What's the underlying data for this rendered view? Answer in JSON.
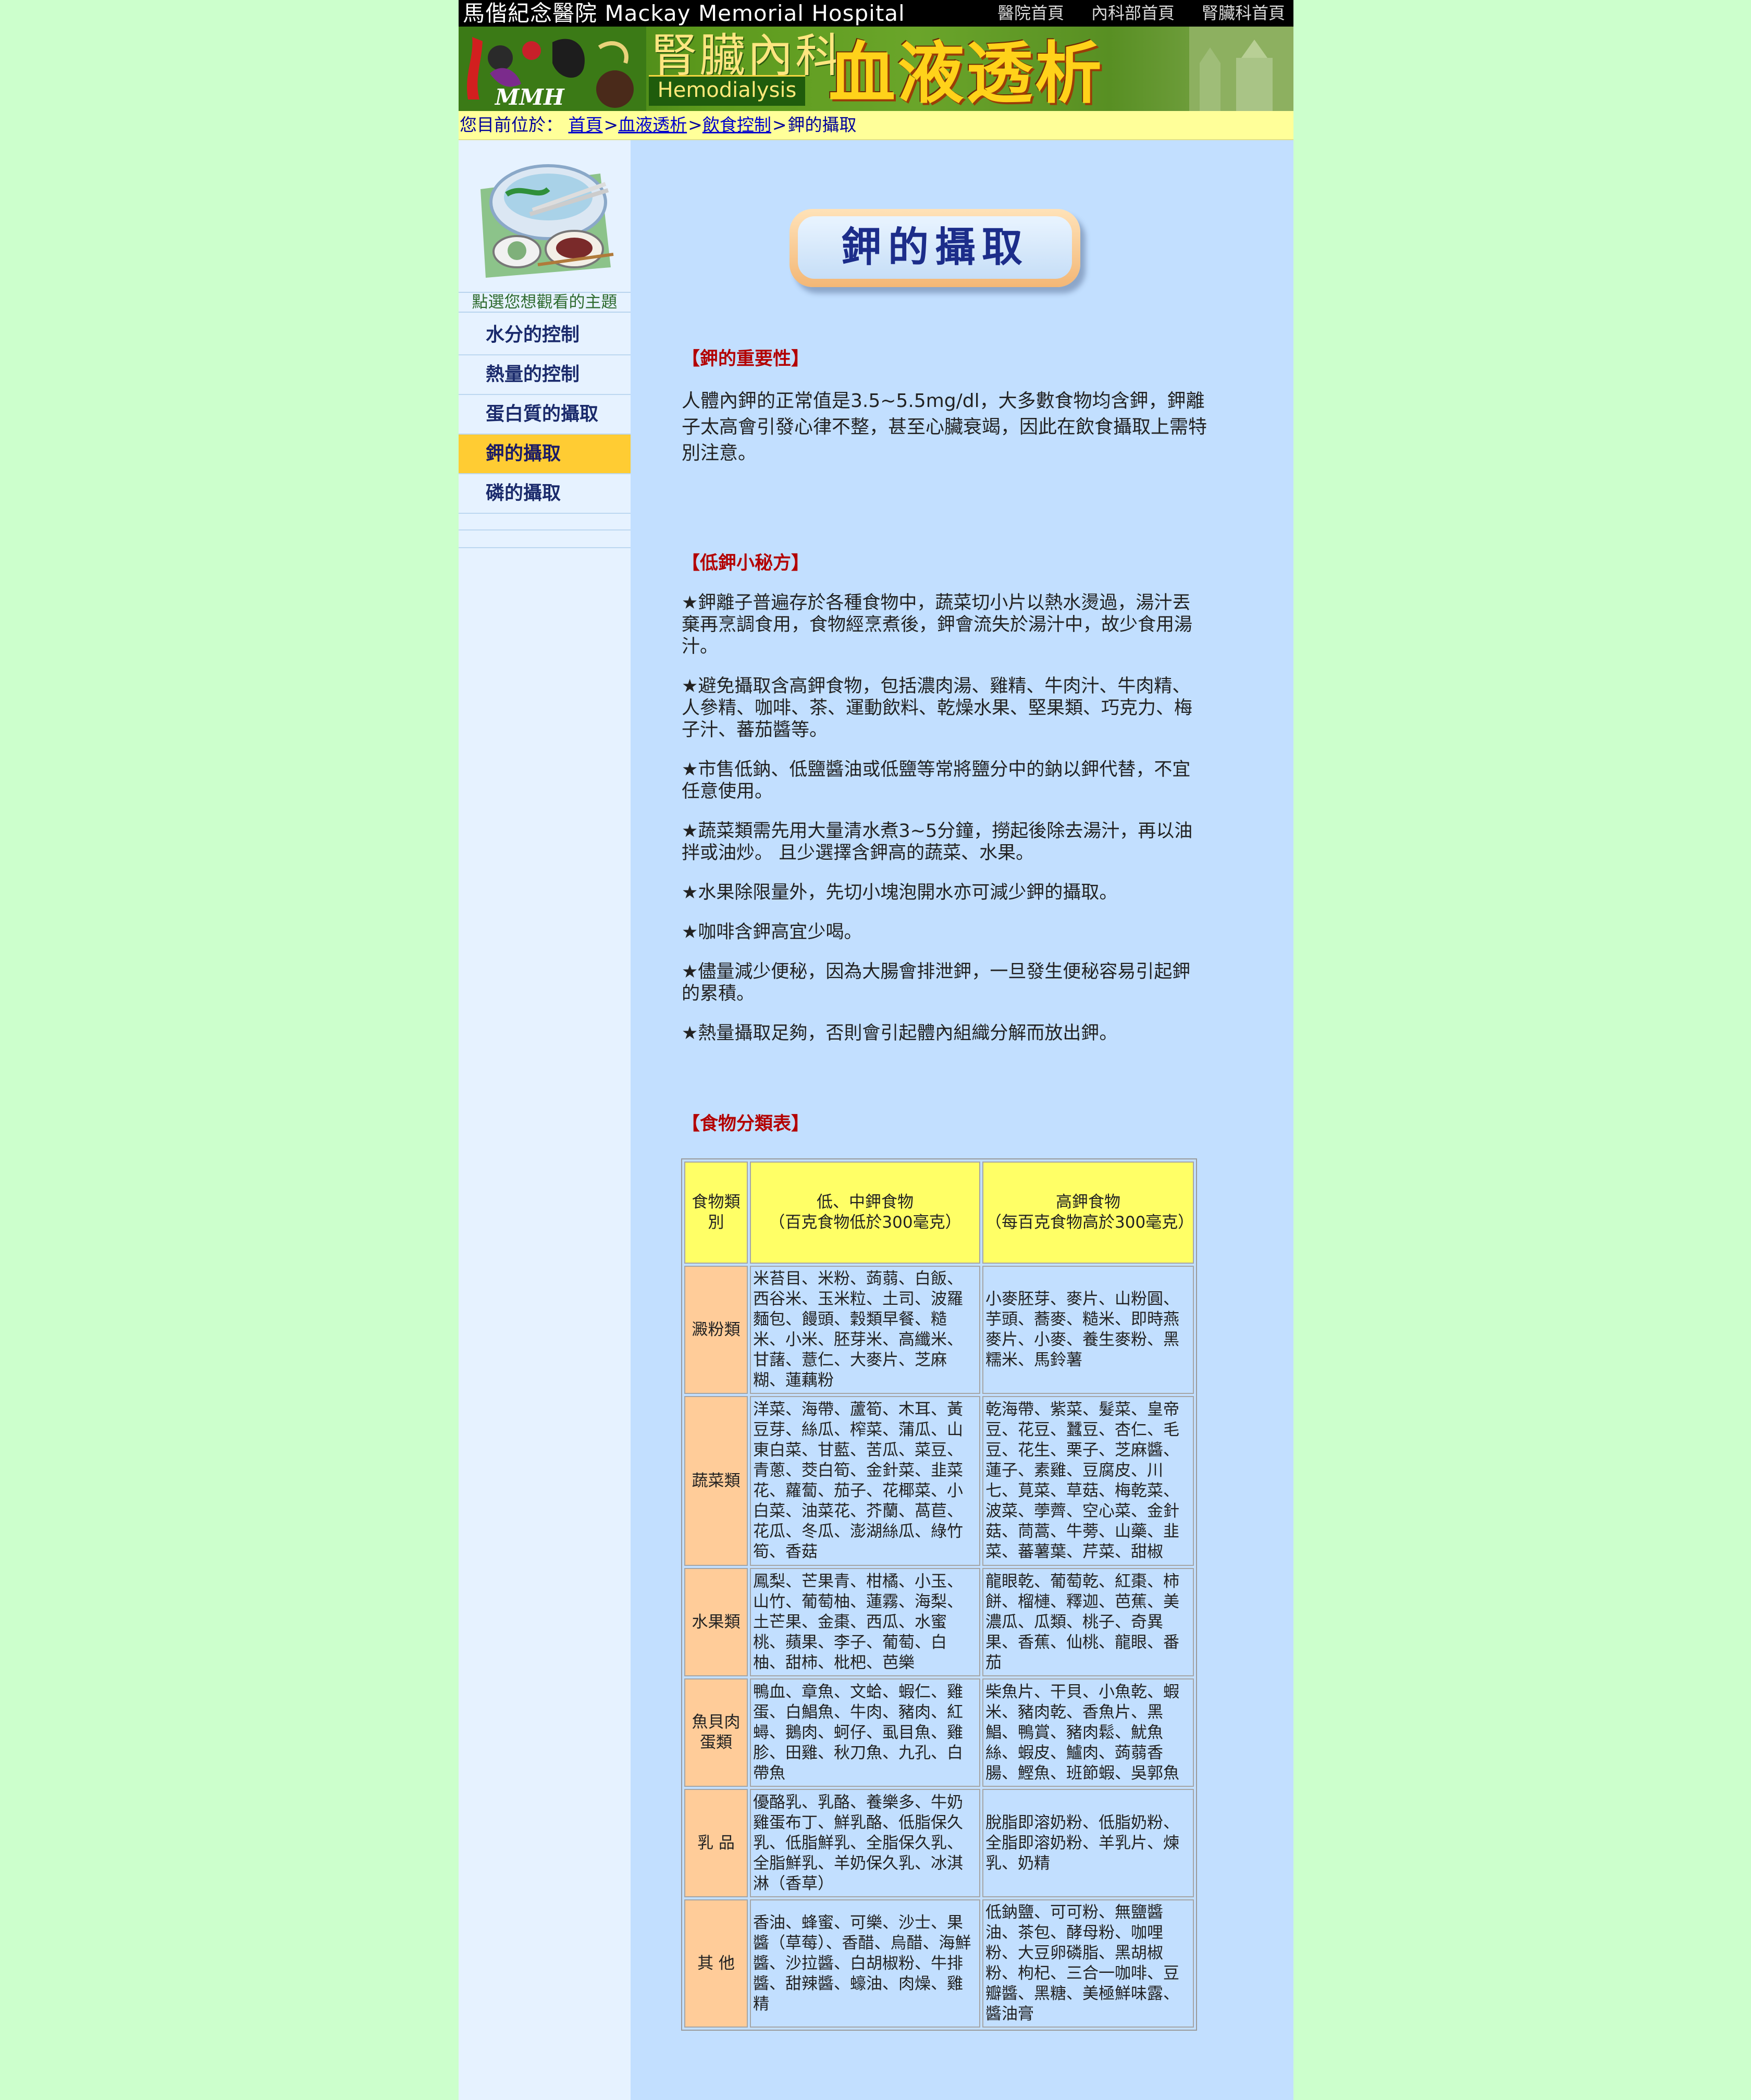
{
  "header": {
    "hospital_name": "馬偕紀念醫院 Mackay Memorial Hospital",
    "nav": [
      "醫院首頁",
      "內科部首頁",
      "腎臟科首頁"
    ],
    "banner_dept": "腎臟內科",
    "banner_en": "Hemodialysis",
    "banner_title": "血液透析",
    "logo_text": "MMH"
  },
  "breadcrumb": {
    "prefix": "您目前位於：",
    "links": [
      "首頁",
      "血液透析",
      "飲食控制"
    ],
    "separator": ">",
    "current": "鉀的攝取"
  },
  "sidebar": {
    "hint": "點選您想觀看的主題",
    "items": [
      {
        "label": "水分的控制",
        "active": false
      },
      {
        "label": "熱量的控制",
        "active": false
      },
      {
        "label": "蛋白質的攝取",
        "active": false
      },
      {
        "label": "鉀的攝取",
        "active": true
      },
      {
        "label": "磷的攝取",
        "active": false
      }
    ]
  },
  "content": {
    "page_title": "鉀的攝取",
    "importance": {
      "heading": "【鉀的重要性】",
      "text": "人體內鉀的正常值是3.5~5.5mg/dl，大多數食物均含鉀，鉀離子太高會引發心律不整，甚至心臟衰竭，因此在飲食攝取上需特別注意。"
    },
    "tips": {
      "heading": "【低鉀小秘方】",
      "items": [
        "★鉀離子普遍存於各種食物中，蔬菜切小片以熱水燙過，湯汁丟棄再烹調食用，食物經烹煮後，鉀會流失於湯汁中，故少食用湯汁。",
        "★避免攝取含高鉀食物，包括濃肉湯、雞精、牛肉汁、牛肉精、人參精、咖啡、茶、運動飲料、乾燥水果、堅果類、巧克力、梅子汁、蕃茄醬等。",
        "★市售低鈉、低鹽醬油或低鹽等常將鹽分中的鈉以鉀代替，不宜任意使用。",
        "★蔬菜類需先用大量清水煮3~5分鐘，撈起後除去湯汁，再以油拌或油炒。 且少選擇含鉀高的蔬菜、水果。",
        "★水果除限量外，先切小塊泡開水亦可減少鉀的攝取。",
        "★咖啡含鉀高宜少喝。",
        "★儘量減少便秘，因為大腸會排泄鉀，一旦發生便秘容易引起鉀的累積。",
        "★熱量攝取足夠，否則會引起體內組織分解而放出鉀。"
      ]
    },
    "food_table": {
      "heading": "【食物分類表】",
      "headers": {
        "category": "食物類別",
        "low": "低、中鉀食物\n（百克食物低於300毫克）",
        "high": "高鉀食物\n（每百克食物高於300毫克）"
      },
      "rows": [
        {
          "category": "澱粉類",
          "low": "米苔目、米粉、蒟蒻、白飯、西谷米、玉米粒、土司、波羅麵包、饅頭、穀類早餐、糙米、小米、胚芽米、高纖米、甘藷、薏仁、大麥片、芝麻糊、蓮藕粉",
          "high": "小麥胚芽、麥片、山粉圓、芋頭、蕎麥、糙米、即時燕麥片、小麥、養生麥粉、黑糯米、馬鈴薯"
        },
        {
          "category": "蔬菜類",
          "low": "洋菜、海帶、蘆筍、木耳、黃豆芽、絲瓜、榨菜、蒲瓜、山東白菜、甘藍、苦瓜、菜豆、青蔥、茭白筍、金針菜、韭菜花、蘿蔔、茄子、花椰菜、小白菜、油菜花、芥蘭、萵苣、花瓜、冬瓜、澎湖絲瓜、綠竹筍、香菇",
          "high": "乾海帶、紫菜、髮菜、皇帝豆、花豆、蠶豆、杏仁、毛豆、花生、栗子、芝麻醬、蓮子、素雞、豆腐皮、川七、莧菜、草菇、梅乾菜、波菜、荸薺、空心菜、金針菇、茼蒿、牛蒡、山藥、韭菜、蕃薯葉、芹菜、甜椒"
        },
        {
          "category": "水果類",
          "low": "鳳梨、芒果青、柑橘、小玉、山竹、葡萄柚、蓮霧、海梨、土芒果、金棗、西瓜、水蜜桃、蘋果、李子、葡萄、白柚、甜柿、枇杷、芭樂",
          "high": "龍眼乾、葡萄乾、紅棗、柿餅、榴槤、釋迦、芭蕉、美濃瓜、瓜類、桃子、奇異果、香蕉、仙桃、龍眼、番茄"
        },
        {
          "category": "魚貝肉蛋類",
          "low": "鴨血、章魚、文蛤、蝦仁、雞蛋、白鯧魚、牛肉、豬肉、紅蟳、鵝肉、蚵仔、虱目魚、雞胗、田雞、秋刀魚、九孔、白帶魚",
          "high": "柴魚片、干貝、小魚乾、蝦米、豬肉乾、香魚片、黑鯧、鴨賞、豬肉鬆、魷魚絲、蝦皮、鱸肉、蒟蒻香腸、鰹魚、班節蝦、吳郭魚"
        },
        {
          "category": "乳 品",
          "low": "優酪乳、乳酪、養樂多、牛奶雞蛋布丁、鮮乳酪、低脂保久乳、低脂鮮乳、全脂保久乳、全脂鮮乳、羊奶保久乳、冰淇淋（香草）",
          "high": "脫脂即溶奶粉、低脂奶粉、全脂即溶奶粉、羊乳片、煉乳、奶精"
        },
        {
          "category": "其 他",
          "low": "香油、蜂蜜、可樂、沙士、果醬（草莓）、香醋、烏醋、海鮮醬、沙拉醬、白胡椒粉、牛排醬、甜辣醬、蠔油、肉燥、雞精",
          "high": "低鈉鹽、可可粉、無鹽醬油、茶包、酵母粉、咖哩粉、大豆卵磷脂、黑胡椒粉、枸杞、三合一咖啡、豆瓣醬、黑糖、美極鮮味露、醬油膏"
        }
      ]
    }
  }
}
